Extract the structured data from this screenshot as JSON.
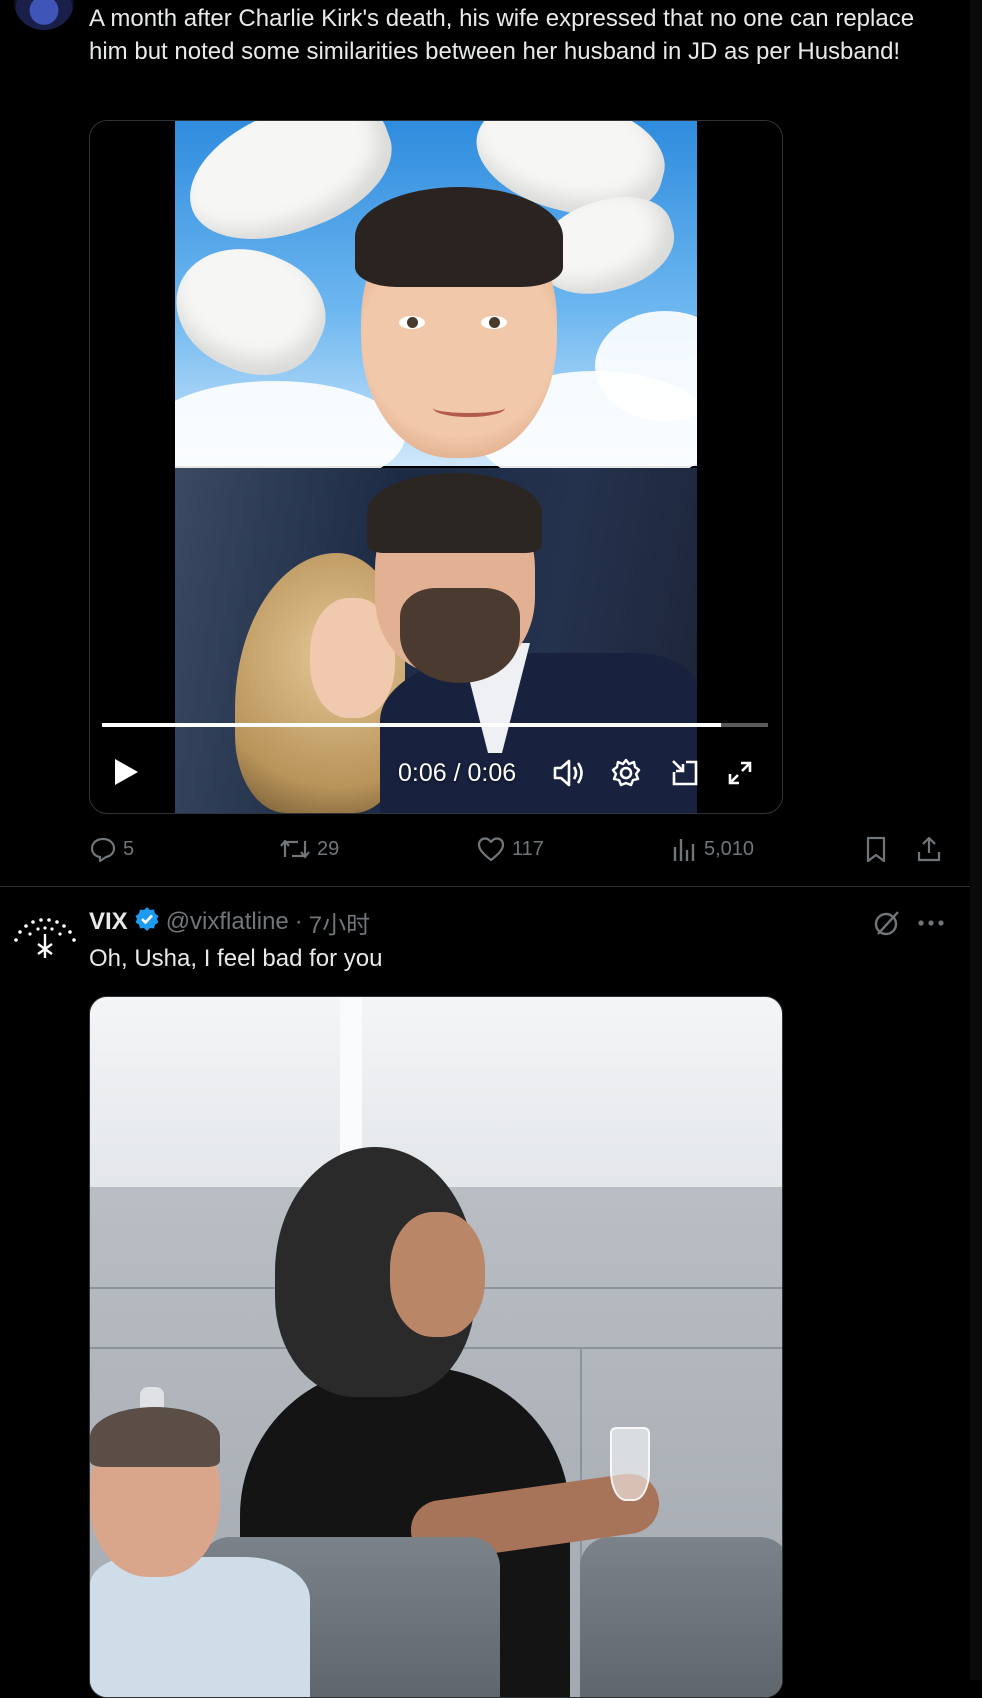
{
  "tweet1": {
    "text": "A month after Charlie Kirk's death, his wife expressed that no one can replace him but noted some similarities between her husband in JD as per Husband!",
    "video": {
      "time": "0:06 / 0:06",
      "progress": 0.93
    },
    "actions": {
      "replies": "5",
      "reposts": "29",
      "likes": "117",
      "views": "5,010"
    }
  },
  "tweet2": {
    "name": "VIX",
    "handle": "@vixflatline",
    "separator": "·",
    "time": "7小时",
    "text": "Oh, Usha, I feel bad for you"
  },
  "colors": {
    "background": "#000000",
    "text": "#e7e9ea",
    "muted": "#71767b",
    "verified": "#1d9bf0",
    "divider": "#2f3336"
  },
  "icons": {
    "reply": "reply-icon",
    "repost": "repost-icon",
    "like": "heart-icon",
    "views": "views-icon",
    "bookmark": "bookmark-icon",
    "share": "share-icon",
    "play": "play-icon",
    "volume": "volume-icon",
    "settings": "gear-icon",
    "pip": "pip-icon",
    "fullscreen": "fullscreen-icon",
    "grok": "grok-icon",
    "more": "more-icon",
    "verified": "verified-badge-icon"
  }
}
